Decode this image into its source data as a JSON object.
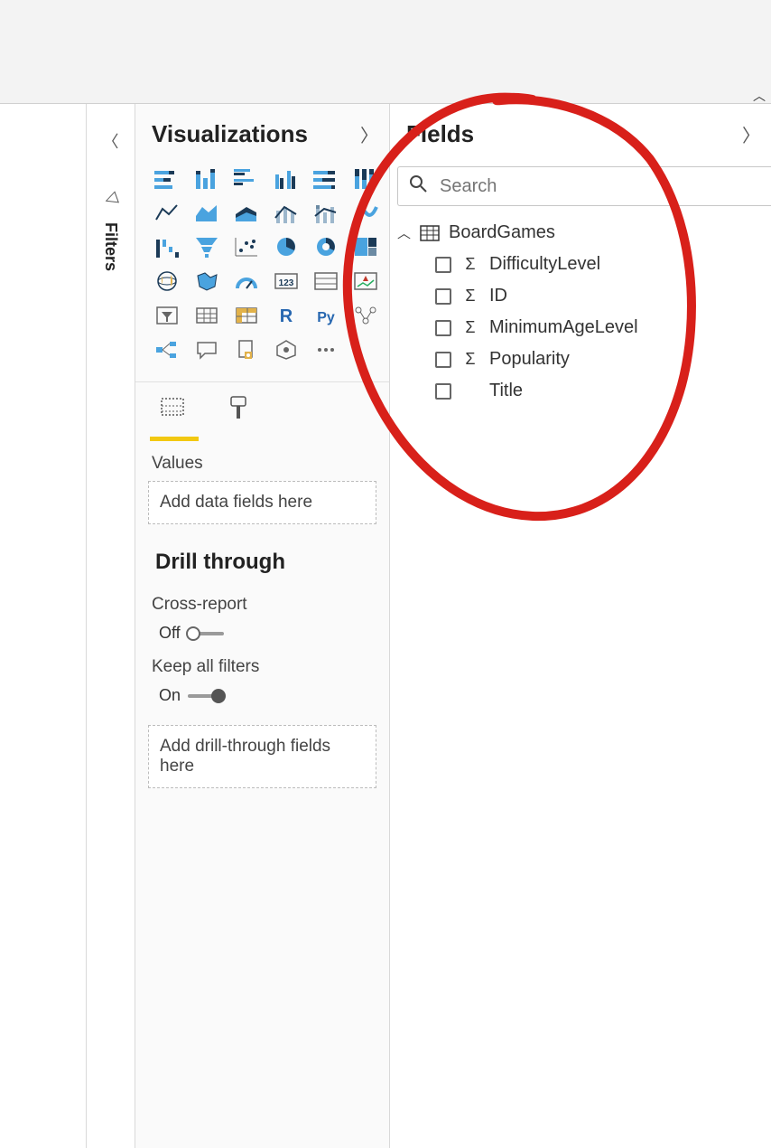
{
  "topbar": {},
  "filters_strip": {
    "label": "Filters"
  },
  "visualizations": {
    "title": "Visualizations",
    "values_label": "Values",
    "values_placeholder": "Add data fields here",
    "drill_header": "Drill through",
    "cross_report": {
      "label": "Cross-report",
      "state": "Off"
    },
    "keep_filters": {
      "label": "Keep all filters",
      "state": "On"
    },
    "drill_placeholder": "Add drill-through fields here",
    "icons": [
      "stacked-bar",
      "stacked-column",
      "clustered-bar",
      "clustered-column",
      "100-stacked-bar",
      "100-stacked-column",
      "line",
      "area",
      "stacked-area",
      "line-clustered",
      "line-stacked",
      "ribbon",
      "waterfall",
      "funnel",
      "scatter",
      "pie",
      "donut",
      "treemap",
      "map",
      "filled-map",
      "gauge",
      "card",
      "multi-card",
      "kpi",
      "slicer",
      "table",
      "matrix",
      "r-visual",
      "py-visual",
      "key-influencers",
      "decomposition",
      "qa",
      "paginated",
      "arcgis",
      "more",
      ""
    ]
  },
  "fields": {
    "title": "Fields",
    "search_placeholder": "Search",
    "table": {
      "name": "BoardGames",
      "columns": [
        {
          "name": "DifficultyLevel",
          "numeric": true
        },
        {
          "name": "ID",
          "numeric": true
        },
        {
          "name": "MinimumAgeLevel",
          "numeric": true
        },
        {
          "name": "Popularity",
          "numeric": true
        },
        {
          "name": "Title",
          "numeric": false
        }
      ]
    }
  }
}
